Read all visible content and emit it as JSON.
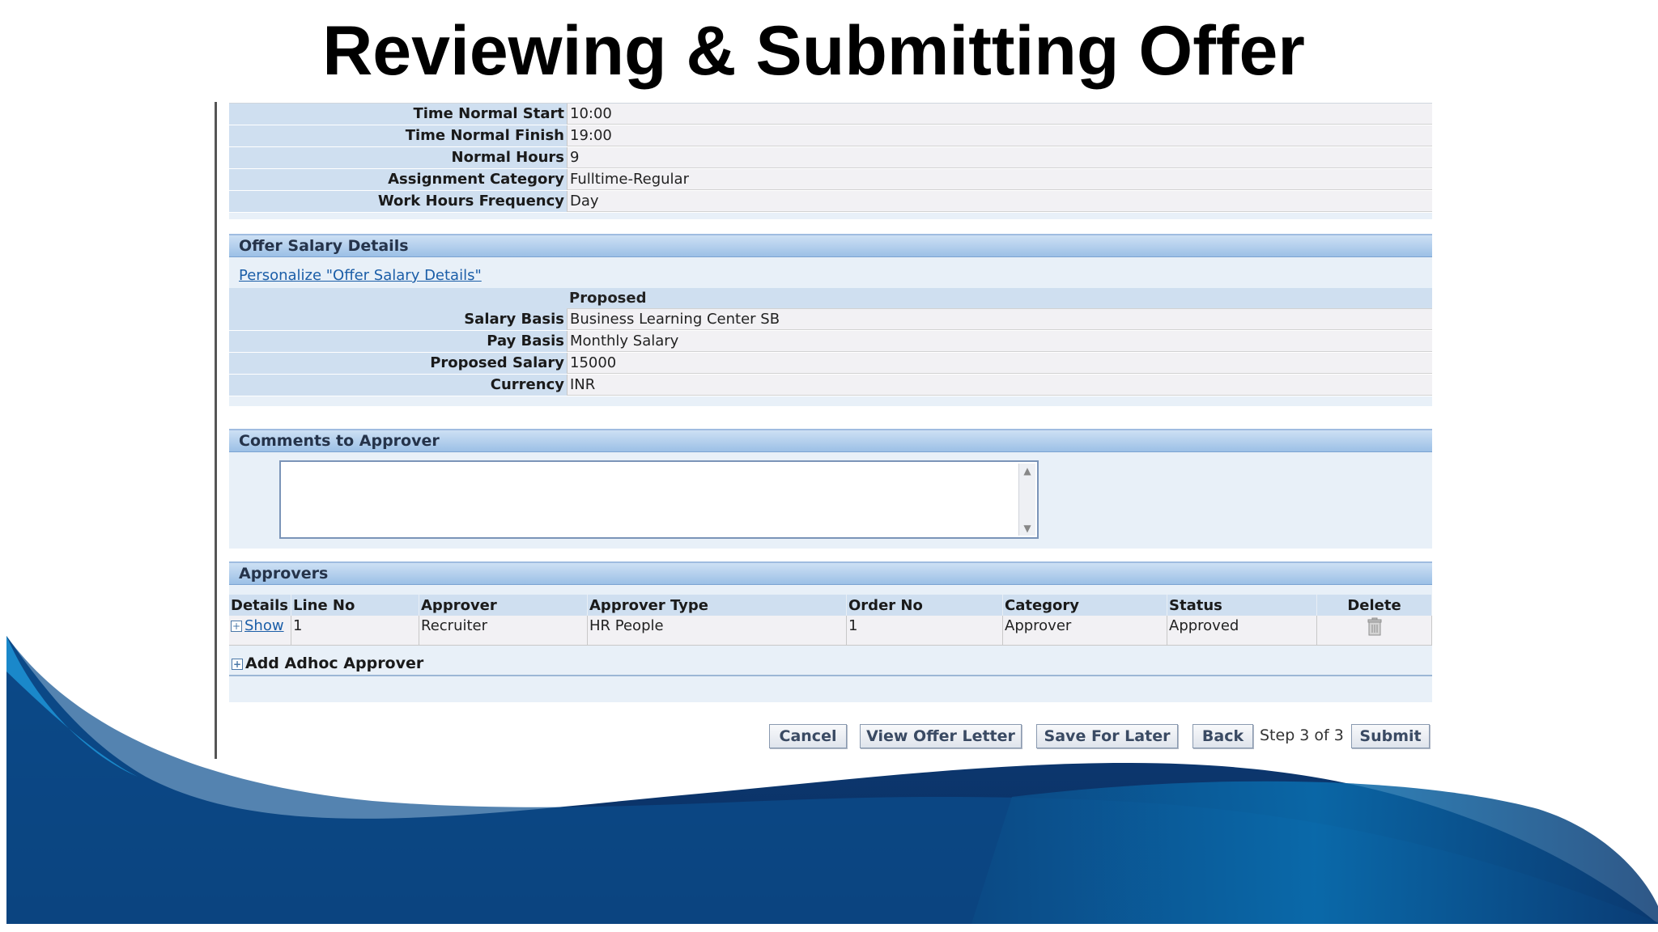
{
  "slide_title": "Reviewing & Submitting Offer",
  "assignment": {
    "rows": [
      {
        "label": "Time Normal Start",
        "value": "10:00"
      },
      {
        "label": "Time Normal Finish",
        "value": "19:00"
      },
      {
        "label": "Normal Hours",
        "value": "9"
      },
      {
        "label": "Assignment Category",
        "value": "Fulltime-Regular"
      },
      {
        "label": "Work Hours Frequency",
        "value": "Day"
      }
    ]
  },
  "salary": {
    "header": "Offer Salary Details",
    "personalize_link": "Personalize \"Offer Salary Details\"",
    "column_header": "Proposed",
    "rows": [
      {
        "label": "Salary Basis",
        "value": "Business Learning Center SB"
      },
      {
        "label": "Pay Basis",
        "value": "Monthly Salary"
      },
      {
        "label": "Proposed Salary",
        "value": "15000"
      },
      {
        "label": "Currency",
        "value": "INR"
      }
    ]
  },
  "comments": {
    "header": "Comments to Approver",
    "value": ""
  },
  "approvers": {
    "header": "Approvers",
    "columns": [
      "Details",
      "Line No",
      "Approver",
      "Approver Type",
      "Order No",
      "Category",
      "Status",
      "Delete"
    ],
    "rows": [
      {
        "details": "Show",
        "line_no": "1",
        "approver": "Recruiter",
        "approver_type": "HR People",
        "order_no": "1",
        "category": "Approver",
        "status": "Approved"
      }
    ],
    "add_adhoc": "Add Adhoc Approver"
  },
  "buttons": {
    "cancel": "Cancel",
    "view_offer_letter": "View Offer Letter",
    "save_for_later": "Save For Later",
    "back": "Back",
    "step": "Step 3 of 3",
    "submit": "Submit"
  },
  "colors": {
    "section_header": "#9cc0e6",
    "label_bg": "#cfdff0",
    "wave_dark": "#0a3566",
    "wave_mid": "#0b5f9e",
    "wave_light": "#1a85c6",
    "link": "#1b5ea8"
  }
}
